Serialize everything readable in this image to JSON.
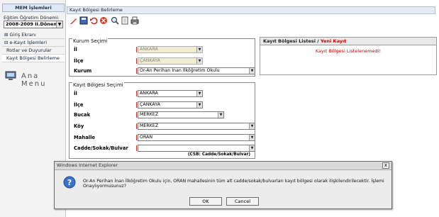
{
  "sidebar": {
    "header": "MEM İşlemleri",
    "term_label": "Eğitim Öğretim Dönemi:",
    "term_value": "2008-2009 II.Dönem",
    "menu": [
      "Giriş Ekranı",
      "e-Kayıt İşlemleri",
      "Rotlar ve Duyurular",
      "Kayıt Bölgesi Belirleme"
    ],
    "ana_menu": "Ana Menu"
  },
  "main": {
    "title": "Kayıt Bölgesi Belirleme",
    "kurum": {
      "legend": "Kurum Seçimi",
      "il_label": "İl",
      "il_value": "ANKARA",
      "ilce_label": "İlçe",
      "ilce_value": "ÇANKAYA",
      "kurum_label": "Kurum",
      "kurum_value": "Or-An Perihan İnan İlköğretim Okulu"
    },
    "bolge": {
      "legend": "Kayıt Bölgesi Seçimi",
      "il_label": "İl",
      "il_value": "ANKARA",
      "ilce_label": "İlçe",
      "ilce_value": "ÇANKAYA",
      "bucak_label": "Bucak",
      "bucak_value": "MERKEZ",
      "koy_label": "Köy",
      "koy_value": "MERKEZ",
      "mahalle_label": "Mahalle",
      "mahalle_value": "ORAN",
      "cadde_label": "Cadde/Sokak/Bulvar",
      "cadde_value": "",
      "csb_note": "(CSB: Cadde/Sokak/Bulvar)"
    },
    "list": {
      "header": "Kayıt Bölgesi Listesi / ",
      "header_red": "Yeni Kayıt",
      "message": "Kayıt Bölgesi Listelenemedi!"
    }
  },
  "dialog": {
    "title": "Windows Internet Explorer",
    "close": "x",
    "message": "Or-An Perihan İnan İlköğretim Okulu için, ORAN mahallesinin tüm alt cadde/sokak/bulvarları kayıt bölgesi olarak ilişkilendirilecektir. İşlemi Onaylıyormusunuz?",
    "ok": "OK",
    "cancel": "Cancel"
  }
}
